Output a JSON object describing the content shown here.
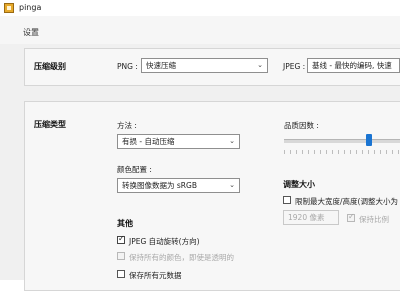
{
  "window": {
    "title": "pinga"
  },
  "settings_label": "设置",
  "compression_level": {
    "section_title": "压缩级别",
    "png_label": "PNG :",
    "png_value": "快速压缩",
    "jpeg_label": "JPEG :",
    "jpeg_value": "基线 - 最快的编码, 快速"
  },
  "compression_type": {
    "section_title": "压缩类型",
    "method_label": "方法 :",
    "method_value": "有损 - 自动压缩",
    "quality_label": "品质因数 :",
    "quality_fraction": 0.73,
    "color_label": "颜色配置 :",
    "color_value": "转换图像数据为 sRGB"
  },
  "resize": {
    "section_title": "调整大小",
    "limit_label": "限制最大宽度/高度(调整大小为",
    "limit_checked": false,
    "size_value": "1920 像素",
    "keep_ratio_label": "保持比例",
    "keep_ratio_checked": true
  },
  "other": {
    "section_title": "其他",
    "auto_rotate_label": "JPEG 自动旋转(方向)",
    "auto_rotate_checked": true,
    "keep_colors_label": "保持所有的颜色，即使是透明的",
    "keep_colors_checked": false,
    "keep_metadata_label": "保存所有元数据",
    "keep_metadata_checked": false
  },
  "colors": {
    "accent": "#1a74d2",
    "panel": "#f7f7f7",
    "background": "#f0f0f0"
  }
}
